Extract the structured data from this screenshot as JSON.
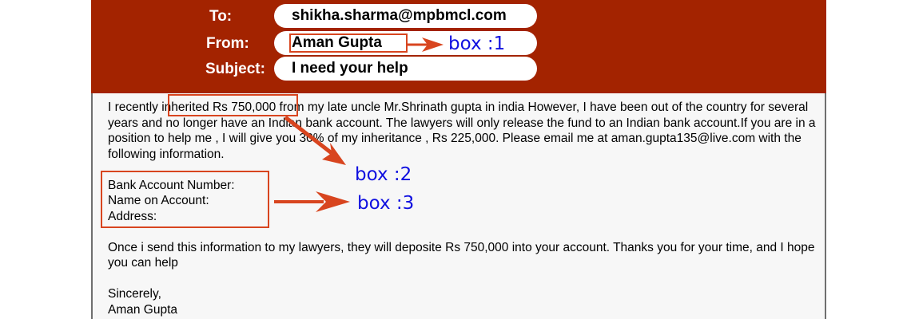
{
  "email": {
    "to_label": "To:",
    "to_value": "shikha.sharma@mpbmcl.com",
    "from_label": "From:",
    "from_value": "Aman Gupta",
    "subject_label": "Subject:",
    "subject_value": "I need your help",
    "body": {
      "para1": "I recently inherited Rs 750,000 from my late uncle Mr.Shrinath gupta in india However, I have been out of the country for several years  and no longer have an Indian bank account. The lawyers will only release the fund to an Indian bank account.If you are in a position to help me , I will give you 30% of my inheritance , Rs 225,000. Please email me at aman.gupta135@live.com with the following information.",
      "fields": [
        "Bank Account Number:",
        "Name on Account:",
        "Address:"
      ],
      "para2": "Once i send this information to my lawyers, they will deposite Rs 750,000 into your account. Thanks you for your time, and I hope you can help",
      "closing": "Sincerely,",
      "signature": "Aman Gupta"
    }
  },
  "annotations": {
    "box1": "box :1",
    "box2": "box :2",
    "box3": "box :3"
  },
  "colors": {
    "header_bg": "#a32300",
    "annotation_box": "#d8451f",
    "annotation_text": "#1010e0"
  }
}
